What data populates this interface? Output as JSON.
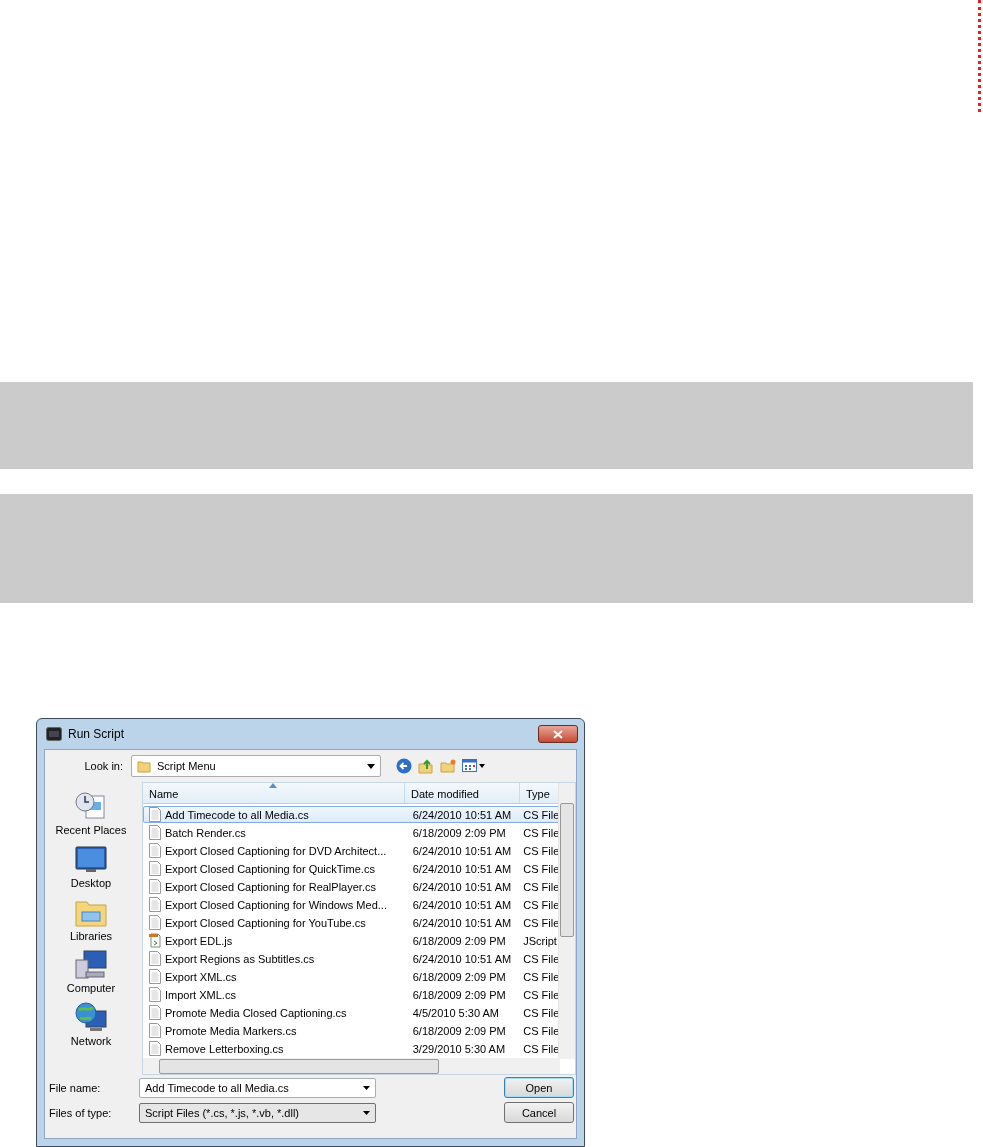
{
  "window": {
    "title": "Run Script"
  },
  "look_in": {
    "label": "Look in:",
    "value": "Script Menu"
  },
  "places": [
    {
      "label": "Recent Places",
      "kind": "recent"
    },
    {
      "label": "Desktop",
      "kind": "desktop"
    },
    {
      "label": "Libraries",
      "kind": "libraries"
    },
    {
      "label": "Computer",
      "kind": "computer"
    },
    {
      "label": "Network",
      "kind": "network"
    }
  ],
  "table": {
    "columns": [
      "Name",
      "Date modified",
      "Type"
    ],
    "rows": [
      {
        "name": "Add Timecode to all Media.cs",
        "date": "6/24/2010 10:51 AM",
        "type": "CS File",
        "kind": "cs",
        "selected": true
      },
      {
        "name": "Batch Render.cs",
        "date": "6/18/2009 2:09 PM",
        "type": "CS File",
        "kind": "cs",
        "selected": false
      },
      {
        "name": "Export Closed Captioning for DVD Architect...",
        "date": "6/24/2010 10:51 AM",
        "type": "CS File",
        "kind": "cs",
        "selected": false
      },
      {
        "name": "Export Closed Captioning for QuickTime.cs",
        "date": "6/24/2010 10:51 AM",
        "type": "CS File",
        "kind": "cs",
        "selected": false
      },
      {
        "name": "Export Closed Captioning for RealPlayer.cs",
        "date": "6/24/2010 10:51 AM",
        "type": "CS File",
        "kind": "cs",
        "selected": false
      },
      {
        "name": "Export Closed Captioning for Windows Med...",
        "date": "6/24/2010 10:51 AM",
        "type": "CS File",
        "kind": "cs",
        "selected": false
      },
      {
        "name": "Export Closed Captioning for YouTube.cs",
        "date": "6/24/2010 10:51 AM",
        "type": "CS File",
        "kind": "cs",
        "selected": false
      },
      {
        "name": "Export EDL.js",
        "date": "6/18/2009 2:09 PM",
        "type": "JScript",
        "kind": "js",
        "selected": false
      },
      {
        "name": "Export Regions as Subtitles.cs",
        "date": "6/24/2010 10:51 AM",
        "type": "CS File",
        "kind": "cs",
        "selected": false
      },
      {
        "name": "Export XML.cs",
        "date": "6/18/2009 2:09 PM",
        "type": "CS File",
        "kind": "cs",
        "selected": false
      },
      {
        "name": "Import XML.cs",
        "date": "6/18/2009 2:09 PM",
        "type": "CS File",
        "kind": "cs",
        "selected": false
      },
      {
        "name": "Promote Media Closed Captioning.cs",
        "date": "4/5/2010 5:30 AM",
        "type": "CS File",
        "kind": "cs",
        "selected": false
      },
      {
        "name": "Promote Media Markers.cs",
        "date": "6/18/2009 2:09 PM",
        "type": "CS File",
        "kind": "cs",
        "selected": false
      },
      {
        "name": "Remove Letterboxing.cs",
        "date": "3/29/2010 5:30 AM",
        "type": "CS File",
        "kind": "cs",
        "selected": false
      }
    ]
  },
  "file_name": {
    "label": "File name:",
    "value": "Add Timecode to all Media.cs"
  },
  "file_type": {
    "label": "Files of type:",
    "value": "Script Files (*.cs, *.js, *.vb, *.dll)"
  },
  "buttons": [
    "Open",
    "Cancel"
  ]
}
